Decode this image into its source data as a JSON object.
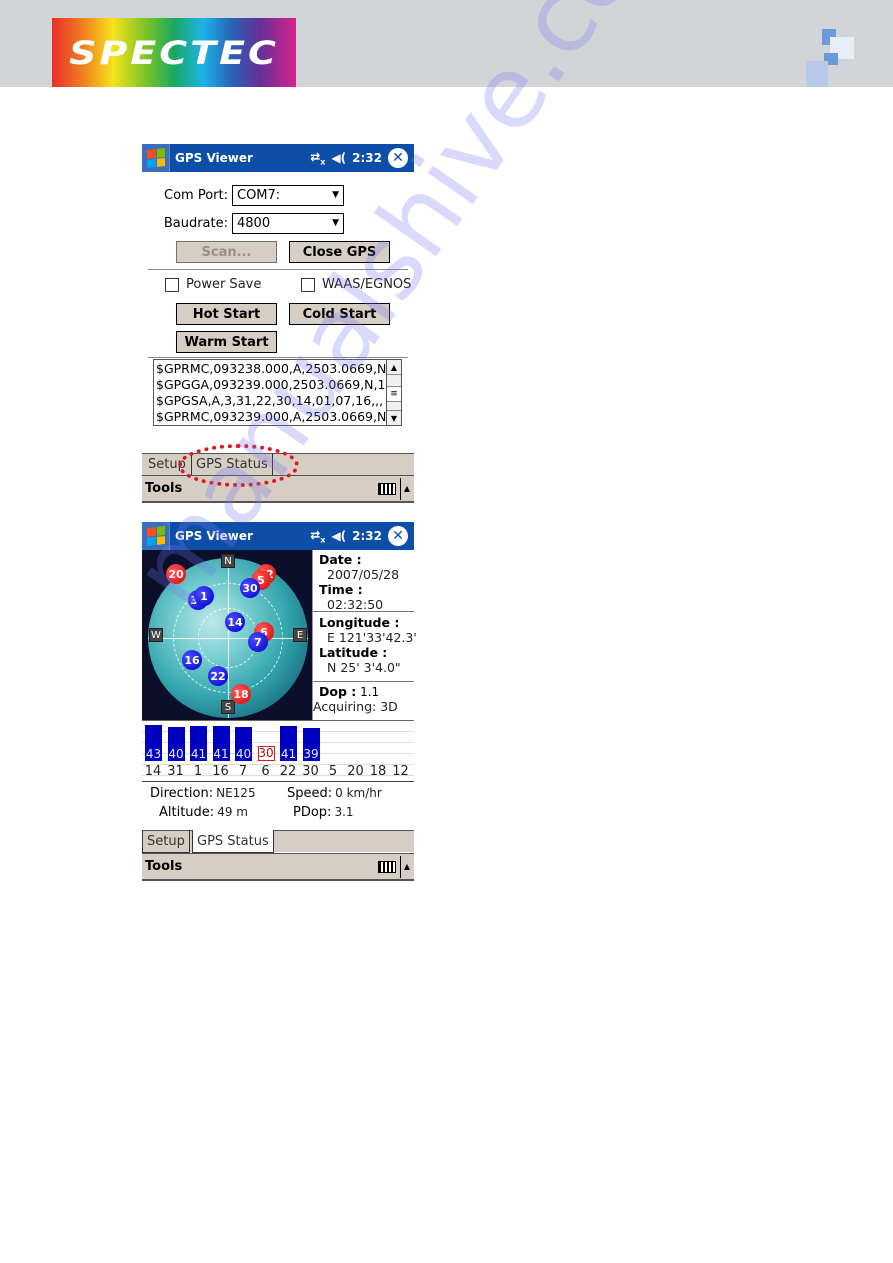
{
  "page": {
    "logo_text": "SPECTEC",
    "watermark": "manualshive.com"
  },
  "screen1": {
    "titlebar": {
      "app_title": "GPS Viewer",
      "time": "2:32",
      "icons": [
        "windows-start-icon",
        "connectivity-icon",
        "speaker-muted-icon",
        "close-icon"
      ]
    },
    "com_port": {
      "label": "Com Port:",
      "value": "COM7:"
    },
    "baudrate": {
      "label": "Baudrate:",
      "value": "4800"
    },
    "buttons": {
      "scan": "Scan...",
      "close_gps": "Close GPS",
      "hot_start": "Hot Start",
      "cold_start": "Cold Start",
      "warm_start": "Warm Start"
    },
    "checkboxes": {
      "power_save": {
        "label": "Power Save",
        "checked": false
      },
      "waas": {
        "label": "WAAS/EGNOS",
        "checked": false
      }
    },
    "nmea_lines": [
      "$GPRMC,093238.000,A,2503.0669,N",
      "$GPGGA,093239.000,2503.0669,N,1",
      "$GPGSA,A,3,31,22,30,14,01,07,16,,,",
      "$GPRMC,093239.000,A,2503.0669,N"
    ],
    "tabs": [
      "Setup",
      "GPS Status"
    ],
    "active_tab": "Setup",
    "menu": {
      "tools": "Tools"
    },
    "highlight_color": "#e0161e"
  },
  "screen2": {
    "titlebar": {
      "app_title": "GPS Viewer",
      "time": "2:32"
    },
    "compass": {
      "n": "N",
      "s": "S",
      "e": "E",
      "w": "W"
    },
    "satellites": [
      {
        "prn": "20",
        "used": false
      },
      {
        "prn": "12",
        "used": false
      },
      {
        "prn": "5",
        "used": false
      },
      {
        "prn": "30",
        "used": true
      },
      {
        "prn": "31",
        "used": true
      },
      {
        "prn": "1",
        "used": true
      },
      {
        "prn": "14",
        "used": true
      },
      {
        "prn": "6",
        "used": false
      },
      {
        "prn": "7",
        "used": true
      },
      {
        "prn": "16",
        "used": true
      },
      {
        "prn": "22",
        "used": true
      },
      {
        "prn": "18",
        "used": false
      }
    ],
    "info": {
      "date_label": "Date :",
      "date": "2007/05/28",
      "time_label": "Time :",
      "time": "02:32:50",
      "longitude_label": "Longitude :",
      "longitude": "E 121'33'42.3'",
      "latitude_label": "Latitude :",
      "latitude": "N  25' 3'4.0\"",
      "dop_label": "Dop :",
      "dop": "1.1",
      "acquiring": "Acquiring: 3D"
    },
    "signal_bars": [
      {
        "prn": "14",
        "snr": 43,
        "used": true
      },
      {
        "prn": "31",
        "snr": 40,
        "used": true
      },
      {
        "prn": "1",
        "snr": 41,
        "used": true
      },
      {
        "prn": "16",
        "snr": 41,
        "used": true
      },
      {
        "prn": "7",
        "snr": 40,
        "used": true
      },
      {
        "prn": "6",
        "snr": 30,
        "used": false
      },
      {
        "prn": "22",
        "snr": 41,
        "used": true
      },
      {
        "prn": "30",
        "snr": 39,
        "used": true
      },
      {
        "prn": "5",
        "snr": null,
        "used": false
      },
      {
        "prn": "20",
        "snr": null,
        "used": false
      },
      {
        "prn": "18",
        "snr": null,
        "used": false
      },
      {
        "prn": "12",
        "snr": null,
        "used": false
      }
    ],
    "stats": {
      "direction_label": "Direction:",
      "direction": "NE125",
      "speed_label": "Speed:",
      "speed": "0 km/hr",
      "altitude_label": "Altitude:",
      "altitude": "49 m",
      "pdop_label": "PDop:",
      "pdop": "3.1"
    },
    "tabs": [
      "Setup",
      "GPS Status"
    ],
    "active_tab": "GPS Status",
    "menu": {
      "tools": "Tools"
    }
  }
}
